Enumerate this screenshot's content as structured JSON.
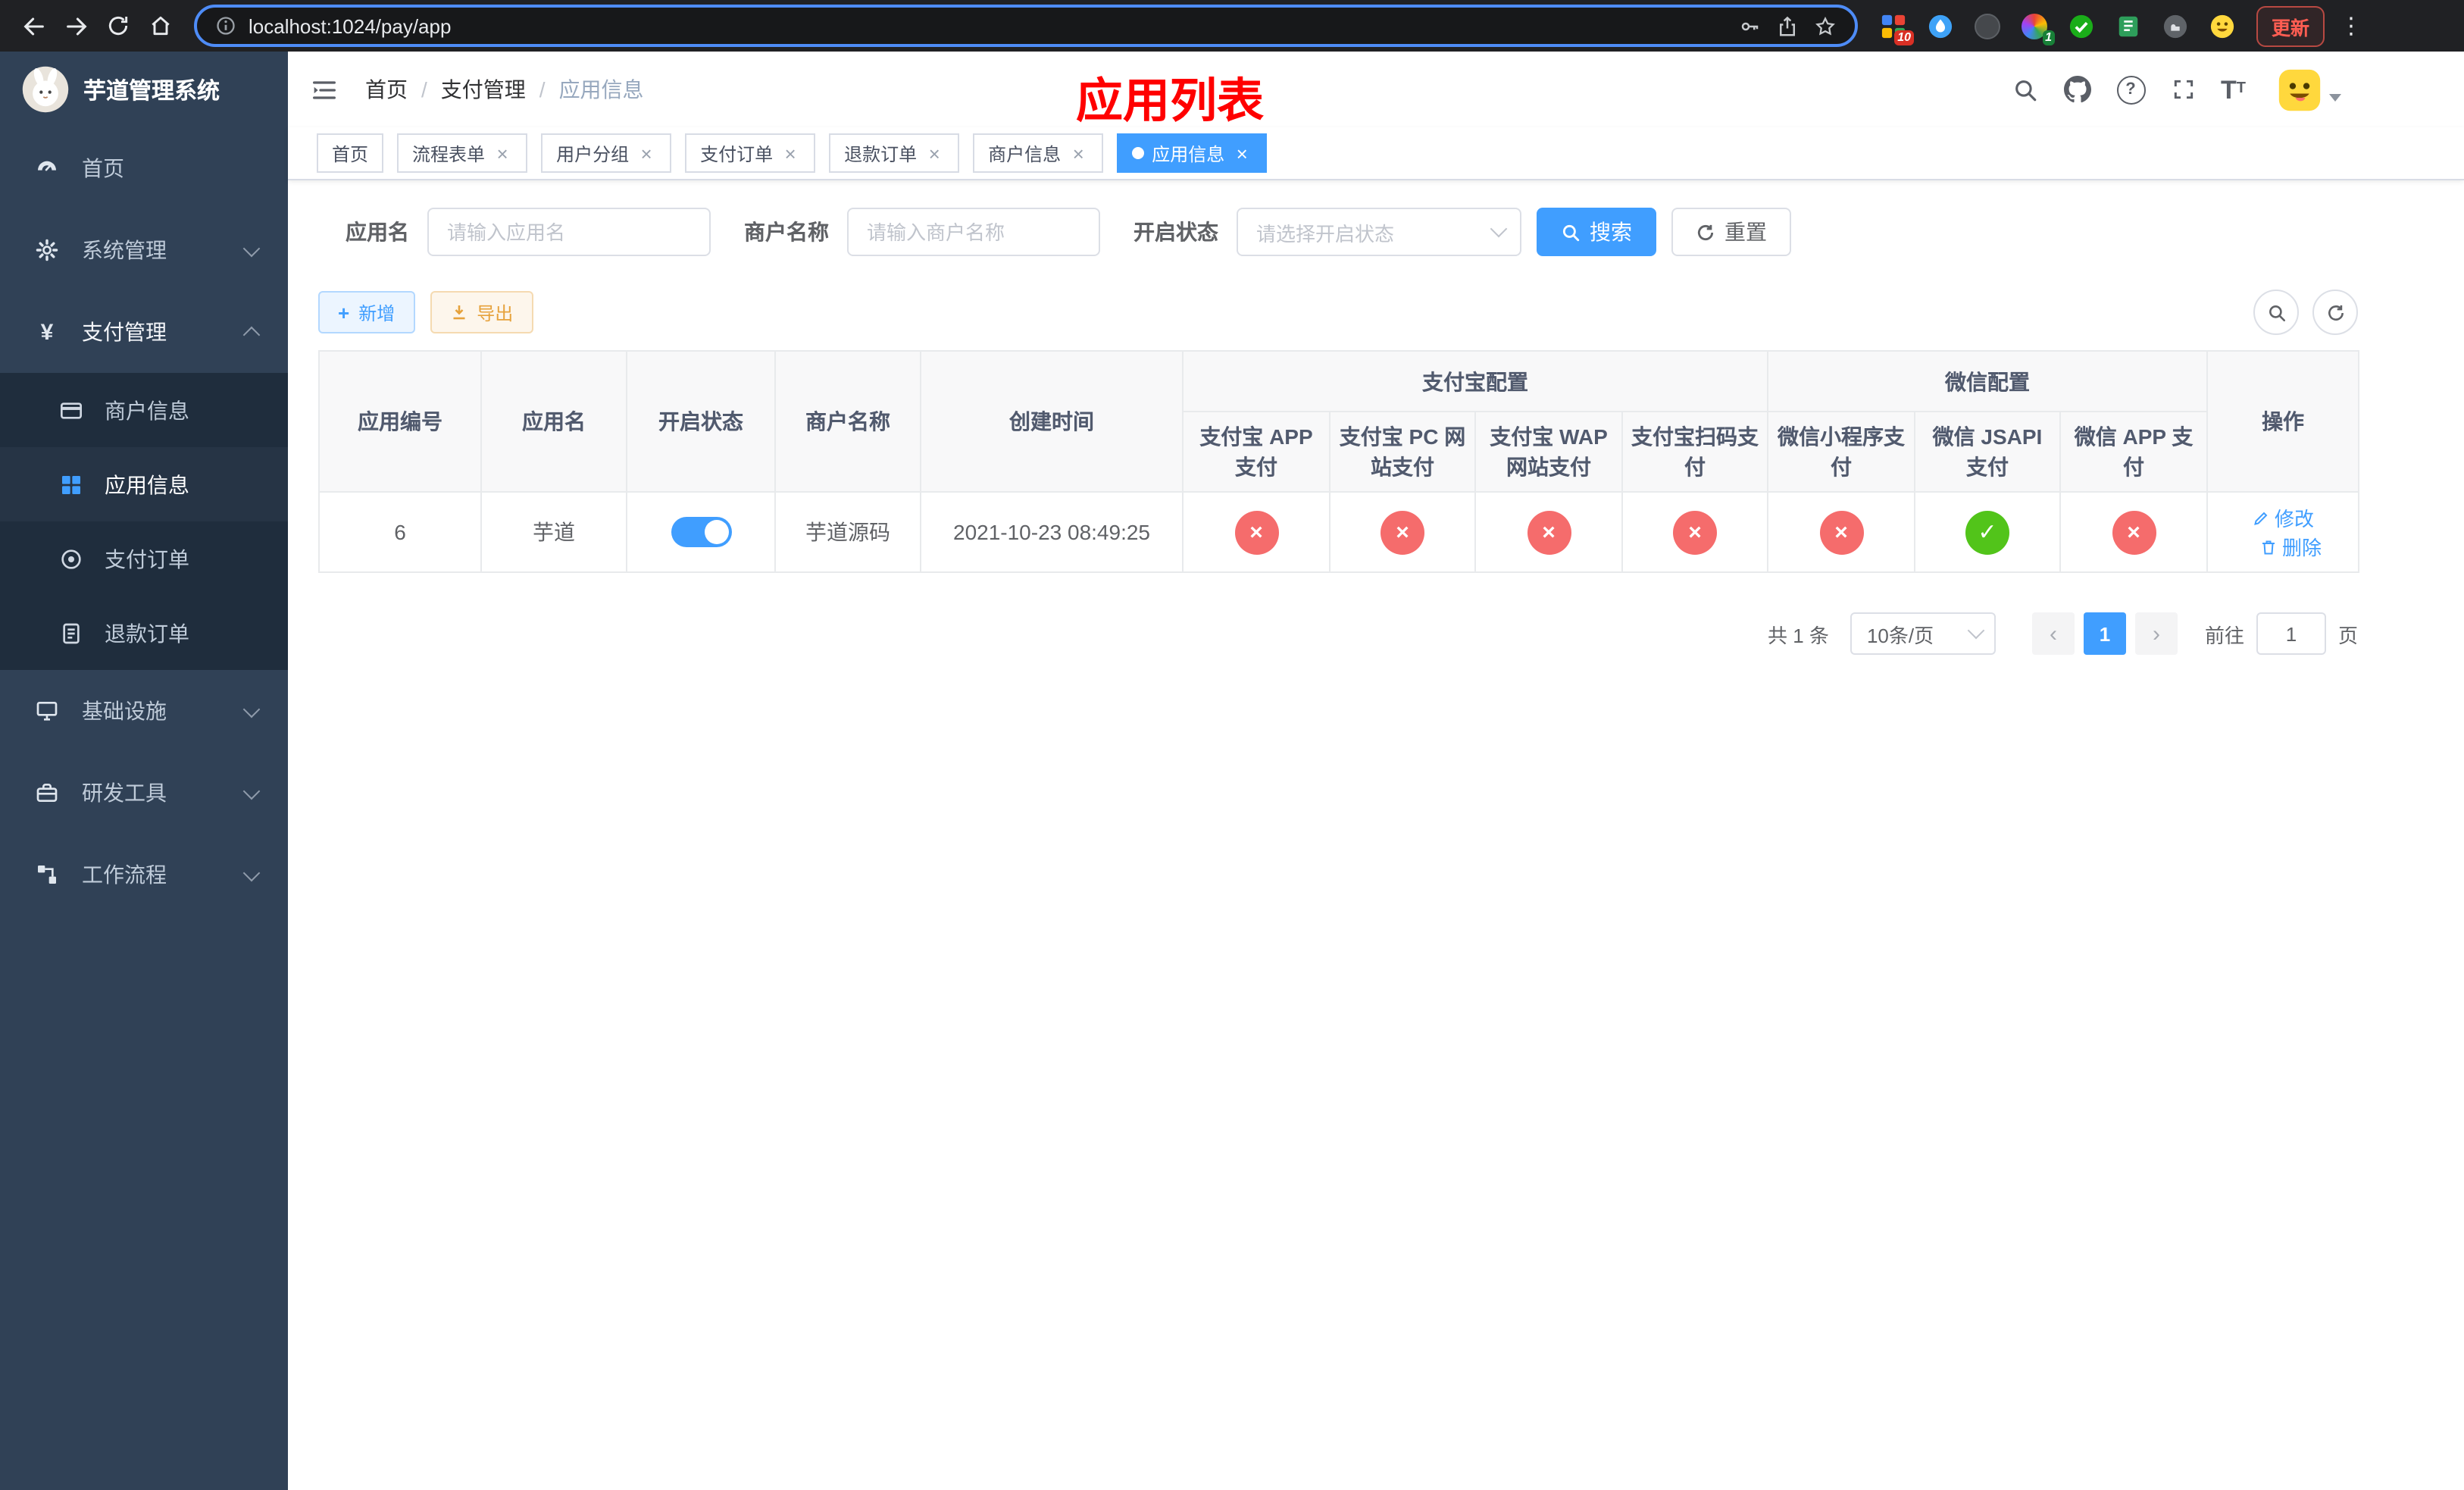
{
  "browser": {
    "url": "localhost:1024/pay/app",
    "update_label": "更新",
    "ext_badge_1": "10",
    "ext_badge_4": "1"
  },
  "sidebar": {
    "title": "芋道管理系统",
    "items": {
      "home": "首页",
      "system": "系统管理",
      "pay": "支付管理",
      "merchant": "商户信息",
      "app": "应用信息",
      "order": "支付订单",
      "refund": "退款订单",
      "infra": "基础设施",
      "devtools": "研发工具",
      "workflow": "工作流程"
    }
  },
  "header": {
    "breadcrumb": {
      "home": "首页",
      "section": "支付管理",
      "current": "应用信息",
      "sep": "/"
    },
    "overlay_title": "应用列表"
  },
  "tabs": {
    "t0": "首页",
    "t1": "流程表单",
    "t2": "用户分组",
    "t3": "支付订单",
    "t4": "退款订单",
    "t5": "商户信息",
    "t6": "应用信息"
  },
  "filters": {
    "app_name_label": "应用名",
    "app_name_placeholder": "请输入应用名",
    "merchant_label": "商户名称",
    "merchant_placeholder": "请输入商户名称",
    "status_label": "开启状态",
    "status_placeholder": "请选择开启状态",
    "search_label": "搜索",
    "reset_label": "重置"
  },
  "toolbar": {
    "add_label": "新增",
    "export_label": "导出"
  },
  "table": {
    "headers": {
      "app_id": "应用编号",
      "app_name": "应用名",
      "status": "开启状态",
      "merchant": "商户名称",
      "created": "创建时间",
      "alipay_group": "支付宝配置",
      "wechat_group": "微信配置",
      "alipay_app": "支付宝 APP 支付",
      "alipay_pc": "支付宝 PC 网站支付",
      "alipay_wap": "支付宝 WAP 网站支付",
      "alipay_qr": "支付宝扫码支付",
      "wx_lite": "微信小程序支付",
      "wx_jsapi": "微信 JSAPI 支付",
      "wx_app": "微信 APP 支付",
      "actions": "操作"
    },
    "row": {
      "id": "6",
      "name": "芋道",
      "enabled": true,
      "merchant": "芋道源码",
      "created": "2021-10-23 08:49:25",
      "alipay_app": false,
      "alipay_pc": false,
      "alipay_wap": false,
      "alipay_qr": false,
      "wx_lite": false,
      "wx_jsapi": true,
      "wx_app": false,
      "edit_label": "修改",
      "delete_label": "删除"
    },
    "status_colors": {
      "pass": "#52c41a",
      "fail": "#f56c6c"
    }
  },
  "pagination": {
    "total": "共 1 条",
    "page_size": "10条/页",
    "page": "1",
    "goto_label": "前往",
    "goto_value": "1",
    "unit_label": "页"
  },
  "theme": {
    "primary": "#409eff",
    "sidebar_bg": "#304156",
    "submenu_bg": "#1f2d3d",
    "title_red": "#ff0000"
  }
}
